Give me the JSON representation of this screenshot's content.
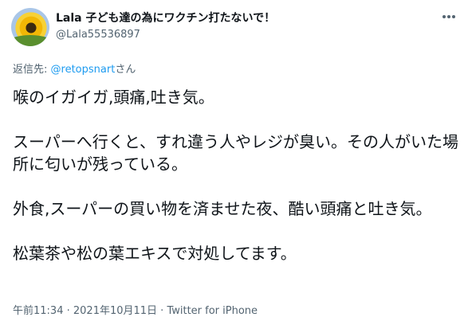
{
  "author": {
    "display_name": "Lala 子ども達の為にワクチン打たないで！",
    "handle": "@Lala55536897",
    "avatar_icon": "sunflower-avatar"
  },
  "menu": {
    "icon": "more-horizontal-icon"
  },
  "reply": {
    "prefix": "返信先:",
    "mention": "@retopsnart",
    "suffix": "さん"
  },
  "body": {
    "paragraphs": [
      "喉のイガイガ,頭痛,吐き気。",
      "スーパーへ行くと、すれ違う人やレジが臭い。その人がいた場所に匂いが残っている。",
      "外食,スーパーの買い物を済ませた夜、酷い頭痛と吐き気。",
      "松葉茶や松の葉エキスで対処してます。"
    ]
  },
  "meta": {
    "time": "午前11:34",
    "separator": " · ",
    "date": "2021年10月11日",
    "source": "Twitter for iPhone"
  },
  "colors": {
    "text": "#0f1419",
    "secondary": "#536471",
    "link": "#1d9bf0"
  }
}
